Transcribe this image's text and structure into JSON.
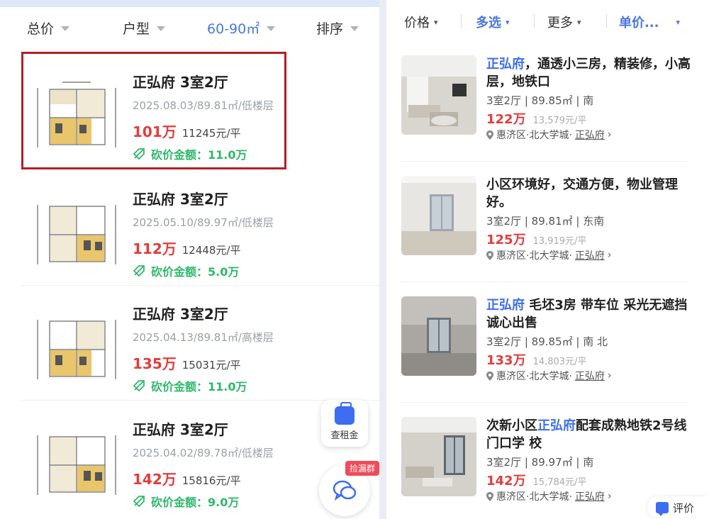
{
  "left_filters": [
    {
      "label": "总价",
      "active": false
    },
    {
      "label": "户型",
      "active": false
    },
    {
      "label": "60-90㎡",
      "active": true
    },
    {
      "label": "排序",
      "active": false
    }
  ],
  "left_listings": [
    {
      "title": "正弘府 3室2厅",
      "meta": "2025.08.03/89.81㎡/低楼层",
      "price": "101万",
      "unit_price": "11245元/平",
      "cut_label": "砍价金额：11.0万",
      "highlighted": true
    },
    {
      "title": "正弘府 3室2厅",
      "meta": "2025.05.10/89.97㎡/低楼层",
      "price": "112万",
      "unit_price": "12448元/平",
      "cut_label": "砍价金额：5.0万",
      "highlighted": false
    },
    {
      "title": "正弘府 3室2厅",
      "meta": "2025.04.13/89.81㎡/高楼层",
      "price": "135万",
      "unit_price": "15031元/平",
      "cut_label": "砍价金额：11.0万",
      "highlighted": false
    },
    {
      "title": "正弘府 3室2厅",
      "meta": "2025.04.02/89.78㎡/低楼层",
      "price": "142万",
      "unit_price": "15816元/平",
      "cut_label": "砍价金额：9.0万",
      "highlighted": false
    }
  ],
  "float_buttons": {
    "rent_label": "查租金",
    "group_badge": "捡漏群"
  },
  "right_filters": [
    {
      "label": "价格",
      "active": false
    },
    {
      "label": "多选",
      "active": true
    },
    {
      "label": "更多",
      "active": false
    },
    {
      "label": "单价...",
      "active": true
    }
  ],
  "right_listings": [
    {
      "title_hl": "正弘府",
      "title_rest": "，通透小三房，精装修，小高层，地铁口",
      "title_pre": "",
      "meta": "3室2厅 | 89.85㎡ | 南",
      "price": "122万",
      "unit_price": "13,579元/平",
      "area": "惠济区·北大学城·",
      "community": "正弘府"
    },
    {
      "title_hl": "",
      "title_rest": "小区环境好，交通方便，物业管理好。",
      "title_pre": "",
      "meta": "3室2厅 | 89.81㎡ | 东南",
      "price": "125万",
      "unit_price": "13,919元/平",
      "area": "惠济区·北大学城·",
      "community": "正弘府"
    },
    {
      "title_hl": "正弘府",
      "title_rest": " 毛坯3房 带车位 采光无遮挡诚心出售",
      "title_pre": "",
      "meta": "3室2厅 | 89.85㎡ | 南 北",
      "price": "133万",
      "unit_price": "14,803元/平",
      "area": "惠济区·北大学城·",
      "community": "正弘府"
    },
    {
      "title_hl": "正弘府",
      "title_rest": "配套成熟地铁2号线门口学 校",
      "title_pre": "次新小区",
      "meta": "3室2厅 | 89.97㎡ | 南",
      "price": "142万",
      "unit_price": "15,784元/平",
      "area": "惠济区·北大学城·",
      "community": "正弘府"
    }
  ],
  "review_label": "评价",
  "colors": {
    "accent": "#4a77e0",
    "price_red": "#e23d3d",
    "cut_green": "#2eb86a",
    "highlight_border": "#b41e24"
  }
}
